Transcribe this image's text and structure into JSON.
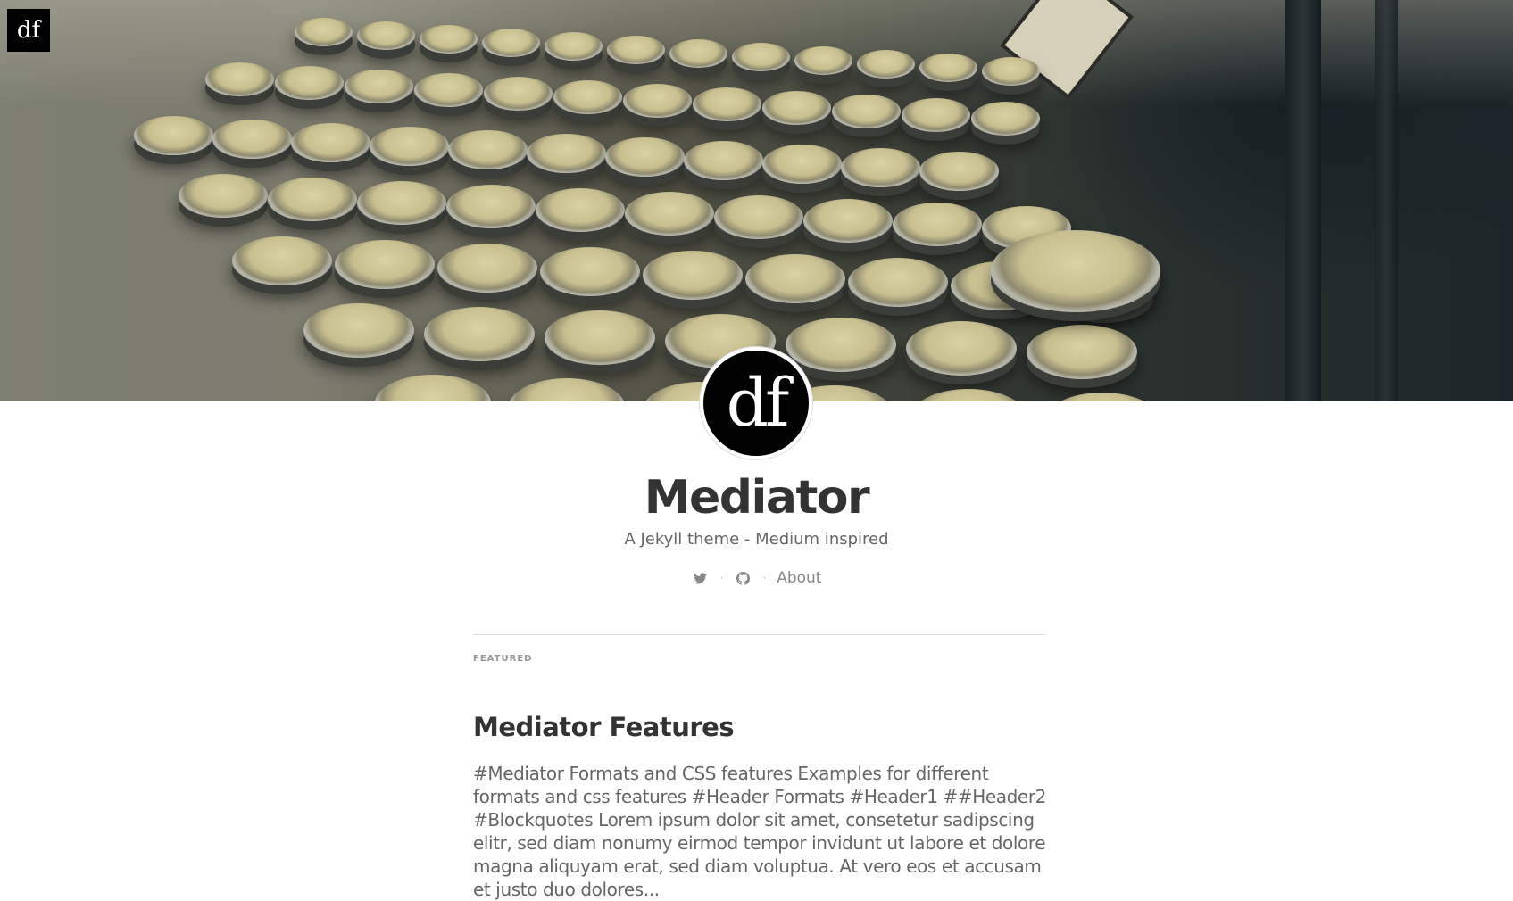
{
  "logo": {
    "text": "df"
  },
  "hero": {
    "description": "typewriter keys cover image"
  },
  "avatar": {
    "text": "df"
  },
  "site": {
    "title": "Mediator",
    "tagline": "A Jekyll theme - Medium inspired"
  },
  "social": {
    "separator": "·",
    "twitter_icon": "twitter-icon",
    "github_icon": "github-icon",
    "about_label": "About"
  },
  "featured": {
    "section_label": "FEATURED",
    "post_title": "Mediator Features",
    "post_excerpt": "#Mediator Formats and CSS features Examples for different formats and css features #Header Formats #Header1 ##Header2 #Blockquotes Lorem ipsum dolor sit amet, consetetur sadipscing elitr, sed diam nonumy eirmod tempor invidunt ut labore et dolore magna aliquyam erat, sed diam voluptua. At vero eos et accusam et justo duo dolores..."
  },
  "colors": {
    "title": "#333333",
    "muted": "#666666",
    "icon": "#888888",
    "divider": "#dddddd"
  }
}
